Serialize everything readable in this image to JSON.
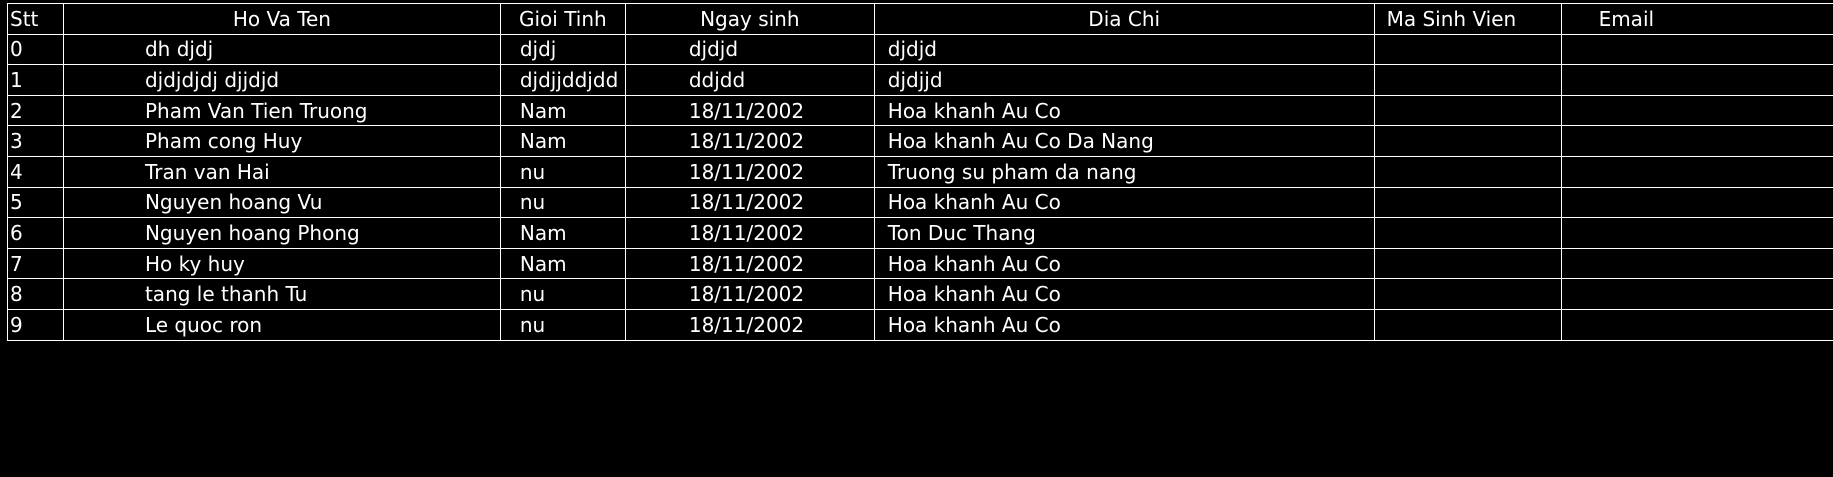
{
  "table": {
    "headers": {
      "stt": "Stt",
      "ho_va_ten": "Ho Va Ten",
      "gioi_tinh": "Gioi Tinh",
      "ngay_sinh": "Ngay sinh",
      "dia_chi": "Dia Chi",
      "ma_sinh_vien": "Ma Sinh Vien",
      "email": "Email"
    },
    "rows": [
      {
        "stt": "0",
        "ho_va_ten": "dh djdj",
        "gioi_tinh": "djdj",
        "ngay_sinh": "djdjd",
        "dia_chi": "djdjd",
        "ma_sinh_vien": "",
        "email": ""
      },
      {
        "stt": "1",
        "ho_va_ten": "djdjdjdj djjdjd",
        "gioi_tinh": "djdjjddjdd",
        "ngay_sinh": "ddjdd",
        "dia_chi": "djdjjd",
        "ma_sinh_vien": "",
        "email": ""
      },
      {
        "stt": "2",
        "ho_va_ten": "Pham Van Tien Truong",
        "gioi_tinh": "Nam",
        "ngay_sinh": "18/11/2002",
        "dia_chi": "Hoa khanh Au Co",
        "ma_sinh_vien": "",
        "email": ""
      },
      {
        "stt": "3",
        "ho_va_ten": "Pham cong Huy",
        "gioi_tinh": "Nam",
        "ngay_sinh": "18/11/2002",
        "dia_chi": "Hoa khanh Au Co Da Nang",
        "ma_sinh_vien": "",
        "email": ""
      },
      {
        "stt": "4",
        "ho_va_ten": "Tran van Hai",
        "gioi_tinh": "nu",
        "ngay_sinh": "18/11/2002",
        "dia_chi": "Truong su pham da nang",
        "ma_sinh_vien": "",
        "email": ""
      },
      {
        "stt": "5",
        "ho_va_ten": "Nguyen hoang Vu",
        "gioi_tinh": "nu",
        "ngay_sinh": "18/11/2002",
        "dia_chi": "Hoa khanh Au Co",
        "ma_sinh_vien": "",
        "email": ""
      },
      {
        "stt": "6",
        "ho_va_ten": "Nguyen hoang Phong",
        "gioi_tinh": "Nam",
        "ngay_sinh": "18/11/2002",
        "dia_chi": "Ton Duc Thang",
        "ma_sinh_vien": "",
        "email": ""
      },
      {
        "stt": "7",
        "ho_va_ten": "Ho ky huy",
        "gioi_tinh": "Nam",
        "ngay_sinh": "18/11/2002",
        "dia_chi": "Hoa khanh Au Co",
        "ma_sinh_vien": "",
        "email": ""
      },
      {
        "stt": "8",
        "ho_va_ten": "tang le thanh Tu",
        "gioi_tinh": "nu",
        "ngay_sinh": "18/11/2002",
        "dia_chi": "Hoa khanh Au Co",
        "ma_sinh_vien": "",
        "email": ""
      },
      {
        "stt": "9",
        "ho_va_ten": "Le quoc ron",
        "gioi_tinh": "nu",
        "ngay_sinh": "18/11/2002",
        "dia_chi": "Hoa khanh Au Co",
        "ma_sinh_vien": "",
        "email": ""
      }
    ]
  },
  "colors": {
    "background": "#000000",
    "text": "#ffffff",
    "grid": "#ffffff"
  }
}
